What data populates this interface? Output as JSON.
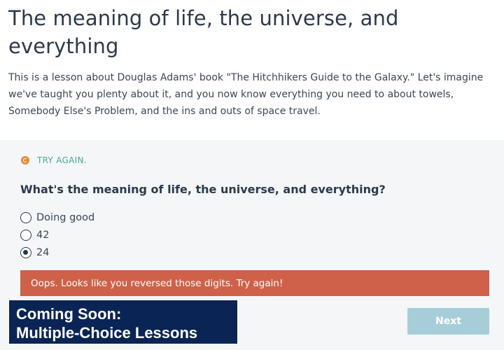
{
  "lesson": {
    "title": "The meaning of life, the universe, and everything",
    "intro": "This is a lesson about Douglas Adams' book \"The Hitchhikers Guide to the Galaxy.\" Let's imagine we've taught you plenty about it, and you now know everything you need to about towels, Somebody Else's Problem, and the ins and outs of space travel."
  },
  "quiz": {
    "status": {
      "label": "TRY AGAIN.",
      "icon": "retry-icon",
      "icon_color": "#e8893a",
      "text_color": "#4aa79b"
    },
    "question": "What's the meaning of life, the universe, and everything?",
    "options": [
      {
        "label": "Doing good",
        "selected": false
      },
      {
        "label": "42",
        "selected": false
      },
      {
        "label": "24",
        "selected": true
      }
    ],
    "feedback": {
      "text": "Oops. Looks like you reversed those digits. Try again!",
      "color": "#cf614a"
    },
    "next_label": "Next",
    "next_color": "#a7ced8"
  },
  "promo": {
    "line1": "Coming Soon:",
    "line2": "Multiple-Choice Lessons",
    "color": "#0b2456"
  }
}
